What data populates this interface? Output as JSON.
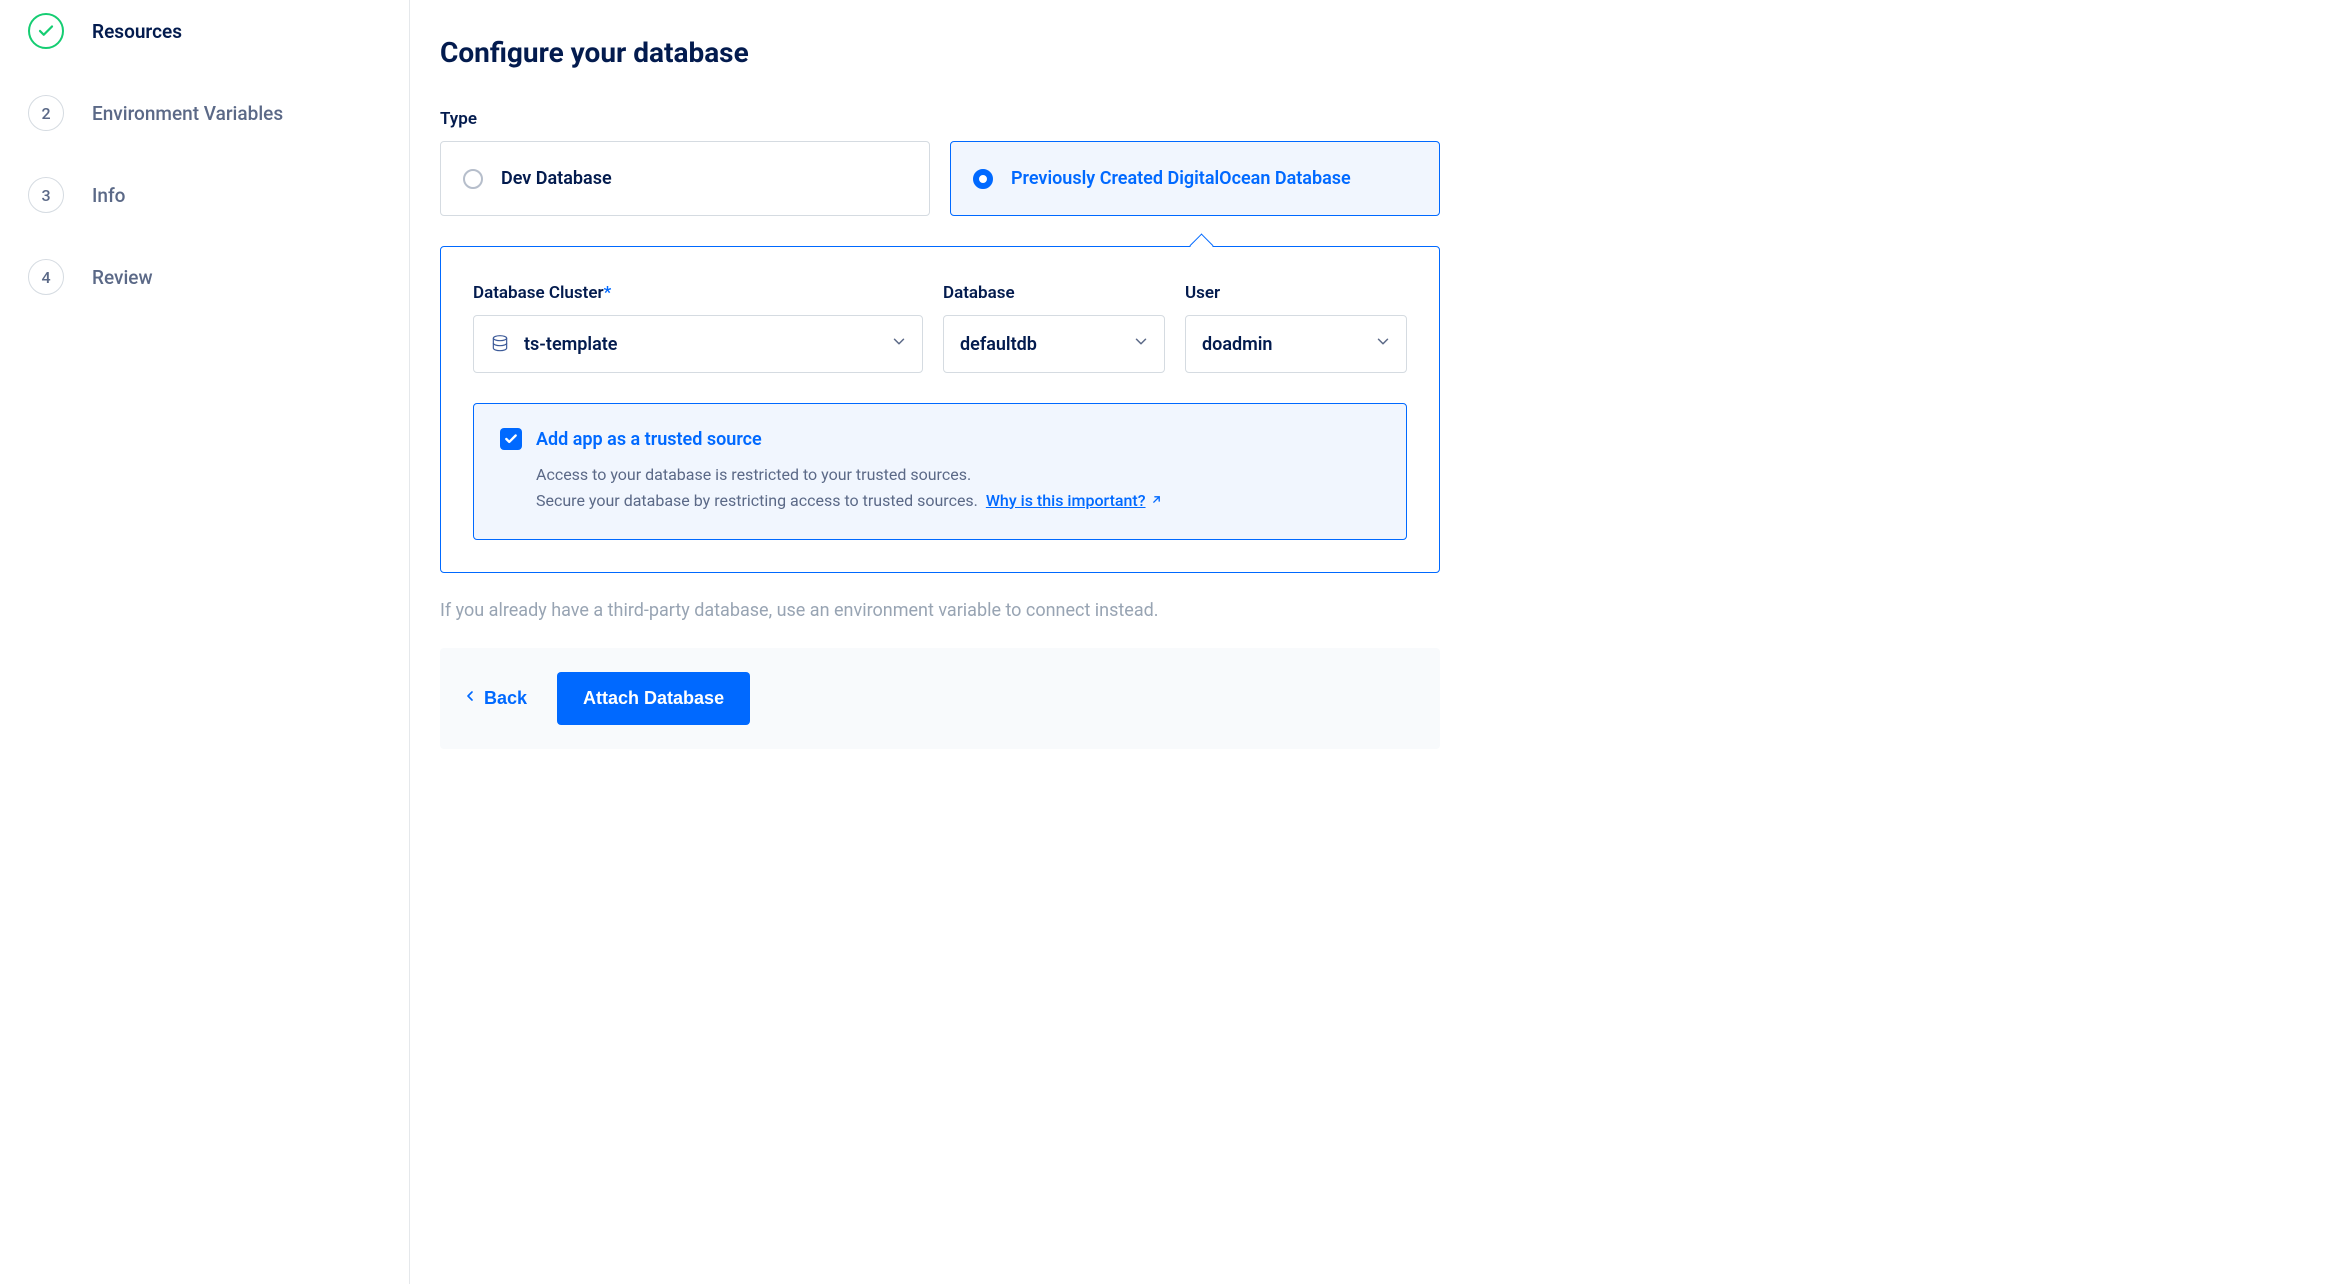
{
  "sidebar": {
    "steps": [
      {
        "done": true,
        "num": "",
        "label": "Resources"
      },
      {
        "done": false,
        "num": "2",
        "label": "Environment Variables"
      },
      {
        "done": false,
        "num": "3",
        "label": "Info"
      },
      {
        "done": false,
        "num": "4",
        "label": "Review"
      }
    ]
  },
  "main": {
    "title": "Configure your database",
    "type_label": "Type",
    "radio_dev": "Dev Database",
    "radio_prev": "Previously Created DigitalOcean Database",
    "cluster_label": "Database Cluster",
    "cluster_value": "ts-template",
    "database_label": "Database",
    "database_value": "defaultdb",
    "user_label": "User",
    "user_value": "doadmin",
    "trusted_label": "Add app as a trusted source",
    "trusted_line1": "Access to your database is restricted to your trusted sources.",
    "trusted_line2": "Secure your database by restricting access to trusted sources.",
    "trusted_link": "Why is this important?",
    "hint": "If you already have a third-party database, use an environment variable to connect instead.",
    "back_label": "Back",
    "attach_label": "Attach Database"
  }
}
